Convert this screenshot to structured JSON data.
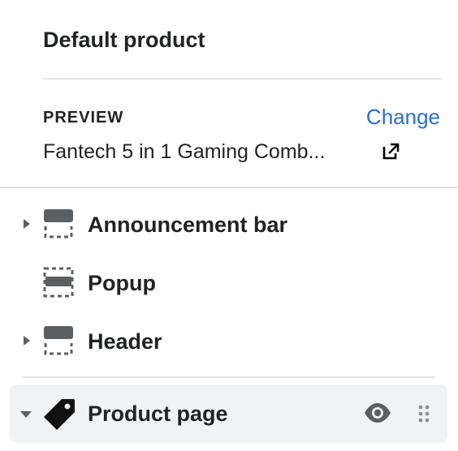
{
  "header": {
    "title": "Default product"
  },
  "preview": {
    "label": "PREVIEW",
    "change_label": "Change",
    "product_name": "Fantech 5 in 1 Gaming Comb..."
  },
  "sections": [
    {
      "label": "Announcement bar",
      "icon": "section-layout-icon",
      "expandable": true
    },
    {
      "label": "Popup",
      "icon": "popup-layout-icon",
      "expandable": false
    },
    {
      "label": "Header",
      "icon": "section-layout-icon",
      "expandable": true
    }
  ],
  "template": {
    "label": "Product page",
    "icon": "tag-icon",
    "expanded": true
  },
  "colors": {
    "text": "#202223",
    "link": "#2c6ecb",
    "divider": "#e1e3e5",
    "selected_row_bg": "#f1f2f3",
    "icon_gray": "#5c5f62"
  }
}
